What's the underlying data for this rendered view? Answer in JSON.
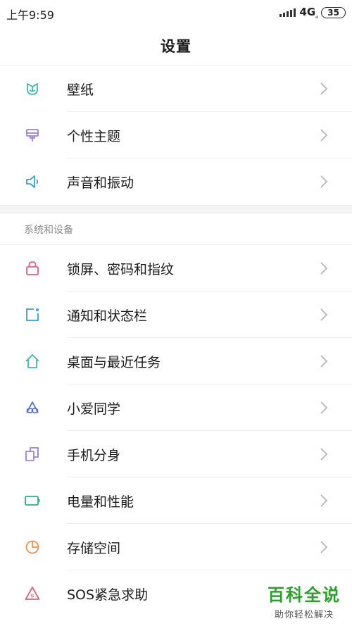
{
  "status_bar": {
    "time": "上午9:59",
    "network": "4G",
    "network_sub": "ᵢₗ",
    "battery": "35"
  },
  "header": {
    "title": "设置"
  },
  "group1": [
    {
      "label": "壁纸",
      "icon": "tulip-icon",
      "color": "#3fb8a8"
    },
    {
      "label": "个性主题",
      "icon": "paint-brush-icon",
      "color": "#9b82d6"
    },
    {
      "label": "声音和振动",
      "icon": "speaker-icon",
      "color": "#3a9fd6"
    }
  ],
  "section2": {
    "title": "系统和设备",
    "items": [
      {
        "label": "锁屏、密码和指纹",
        "icon": "lock-icon",
        "color": "#e0627a"
      },
      {
        "label": "通知和状态栏",
        "icon": "notification-icon",
        "color": "#3a9fd6"
      },
      {
        "label": "桌面与最近任务",
        "icon": "home-icon",
        "color": "#3fb8a8"
      },
      {
        "label": "小爱同学",
        "icon": "xiaoai-icon",
        "color": "#4a6fd6"
      },
      {
        "label": "手机分身",
        "icon": "dual-phone-icon",
        "color": "#9b82d6"
      },
      {
        "label": "电量和性能",
        "icon": "battery-icon",
        "color": "#2fae8f"
      },
      {
        "label": "存储空间",
        "icon": "pie-chart-icon",
        "color": "#f0904a"
      },
      {
        "label": "SOS紧急求助",
        "icon": "sos-icon",
        "color": "#e0627a"
      }
    ]
  },
  "watermark": {
    "main": "百科全说",
    "sub": "助你轻松解决"
  }
}
